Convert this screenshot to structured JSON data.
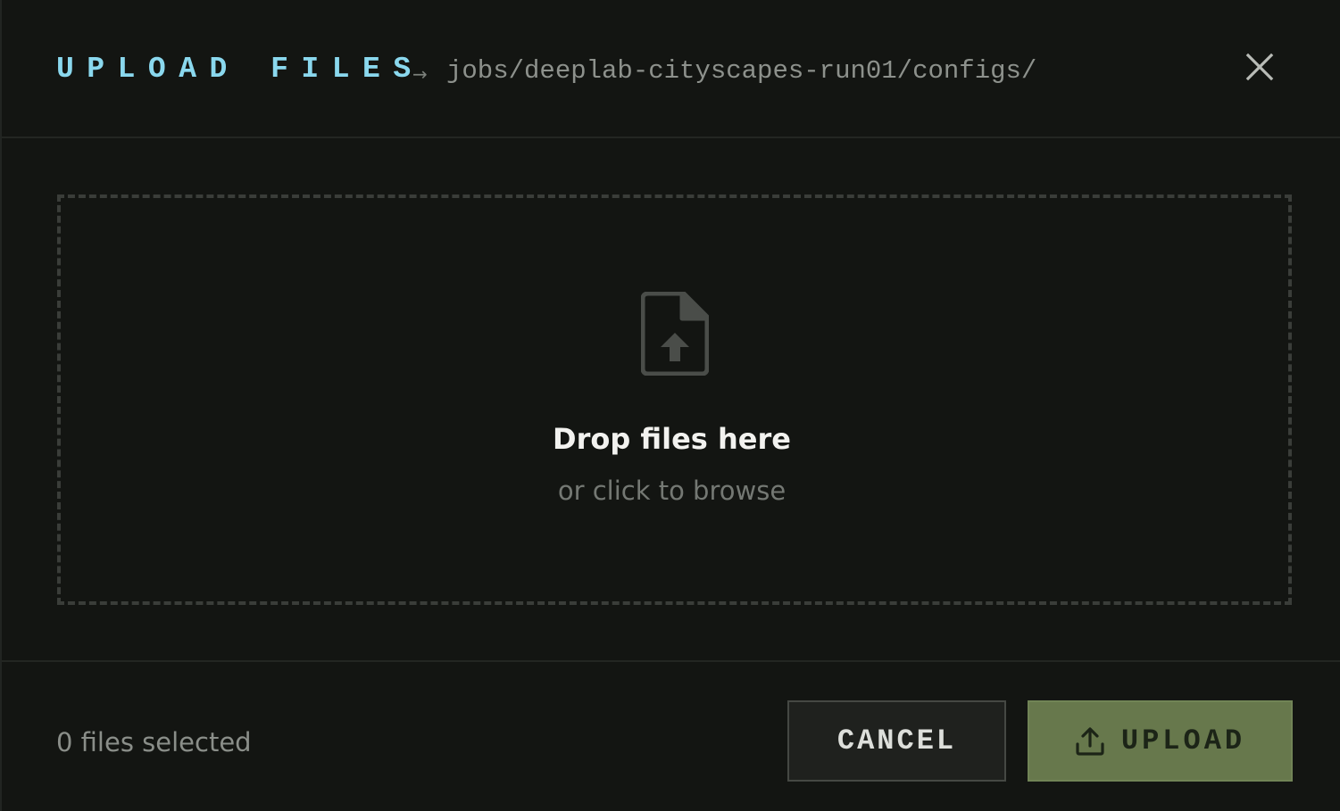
{
  "header": {
    "title": "UPLOAD FILES",
    "arrow": "→",
    "path": "jobs/deeplab-cityscapes-run01/configs/",
    "close_icon": "close-icon"
  },
  "dropzone": {
    "icon": "file-upload-icon",
    "title": "Drop files here",
    "subtitle": "or click to browse"
  },
  "footer": {
    "file_count": "0 files selected",
    "cancel_label": "CANCEL",
    "upload_label": "UPLOAD",
    "upload_icon": "upload-icon"
  },
  "colors": {
    "background": "#131512",
    "title_accent": "#8ad8ee",
    "upload_button": "#67784c",
    "cancel_button": "#1f211e",
    "dropzone_border": "#3a3d39"
  }
}
